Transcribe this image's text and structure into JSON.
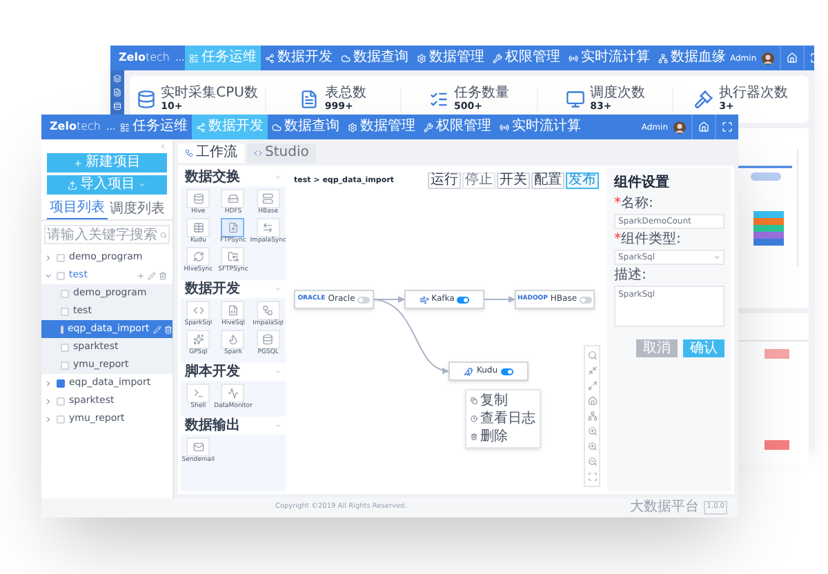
{
  "back_window": {
    "logo": {
      "main": "Zelo",
      "sub": "tech"
    },
    "more": "...",
    "nav": [
      {
        "label": "任务运维",
        "selected": true
      },
      {
        "label": "数据开发",
        "selected": false
      },
      {
        "label": "数据查询",
        "selected": false
      },
      {
        "label": "数据管理",
        "selected": false
      },
      {
        "label": "权限管理",
        "selected": false
      },
      {
        "label": "实时流计算",
        "selected": false
      },
      {
        "label": "数据血缘",
        "selected": false
      }
    ],
    "user": "Admin",
    "stats": [
      {
        "label": "实时采集CPU数",
        "value": "10+"
      },
      {
        "label": "表总数",
        "value": "999+"
      },
      {
        "label": "任务数量",
        "value": "500+"
      },
      {
        "label": "调度次数",
        "value": "83+"
      },
      {
        "label": "执行器次数",
        "value": "3+"
      }
    ]
  },
  "window": {
    "logo": {
      "main": "Zelo",
      "sub": "tech"
    },
    "more": "...",
    "nav": [
      {
        "label": "任务运维",
        "selected": false
      },
      {
        "label": "数据开发",
        "selected": true
      },
      {
        "label": "数据查询",
        "selected": false
      },
      {
        "label": "数据管理",
        "selected": false
      },
      {
        "label": "权限管理",
        "selected": false
      },
      {
        "label": "实时流计算",
        "selected": false
      }
    ],
    "user": "Admin"
  },
  "sidebar": {
    "buttons": [
      "新建项目",
      "导入项目"
    ],
    "tabs": [
      {
        "label": "项目列表",
        "selected": true
      },
      {
        "label": "调度列表",
        "selected": false
      }
    ],
    "search": {
      "placeholder": "请输入关键字搜索"
    },
    "tree": [
      {
        "label": "demo_program",
        "checked": false,
        "selected": false,
        "expanded": false
      },
      {
        "label": "test",
        "checked": false,
        "selected": false,
        "expanded": true,
        "children": [
          {
            "label": "demo_program",
            "checked": false,
            "selected": false
          },
          {
            "label": "test",
            "checked": false,
            "selected": false
          },
          {
            "label": "eqp_data_import",
            "checked": false,
            "selected": true
          },
          {
            "label": "sparktest",
            "checked": false,
            "selected": false
          },
          {
            "label": "ymu_report",
            "checked": false,
            "selected": false
          }
        ]
      },
      {
        "label": "eqp_data_import",
        "checked": true,
        "selected": false,
        "expanded": false
      },
      {
        "label": "sparktest",
        "checked": false,
        "selected": false,
        "expanded": false
      },
      {
        "label": "ymu_report",
        "checked": false,
        "selected": false,
        "expanded": false
      }
    ]
  },
  "editor_tabs": [
    {
      "label": "工作流",
      "selected": true
    },
    {
      "label": "Studio",
      "selected": false
    }
  ],
  "palette": [
    {
      "title": "数据交换",
      "expanded": true,
      "items": [
        {
          "label": "Hive",
          "selected": false
        },
        {
          "label": "HDFS",
          "selected": false
        },
        {
          "label": "HBase",
          "selected": false
        },
        {
          "label": "Kudu",
          "selected": false
        },
        {
          "label": "FTPSync",
          "selected": true
        },
        {
          "label": "ImpalaSync",
          "selected": false
        },
        {
          "label": "HiveSync",
          "selected": false
        },
        {
          "label": "SFTPSync",
          "selected": false
        }
      ]
    },
    {
      "title": "数据开发",
      "expanded": true,
      "items": [
        {
          "label": "SparkSql",
          "selected": false
        },
        {
          "label": "HiveSql",
          "selected": false
        },
        {
          "label": "ImpalaSql",
          "selected": false
        },
        {
          "label": "GPSql",
          "selected": false
        },
        {
          "label": "Spark",
          "selected": false
        },
        {
          "label": "PGSQL",
          "selected": false
        }
      ]
    },
    {
      "title": "脚本开发",
      "expanded": true,
      "items": [
        {
          "label": "Shell",
          "selected": false
        },
        {
          "label": "DataMonitor",
          "selected": false
        }
      ]
    },
    {
      "title": "数据输出",
      "expanded": true,
      "items": [
        {
          "label": "Sendemail",
          "selected": false
        }
      ]
    }
  ],
  "canvas": {
    "breadcrumb": "test > eqp_data_import",
    "toolbar": [
      {
        "label": "运行",
        "kind": "default"
      },
      {
        "label": "停止",
        "kind": "disabled"
      },
      {
        "label": "开关",
        "kind": "default"
      },
      {
        "label": "配置",
        "kind": "default"
      },
      {
        "label": "发布",
        "kind": "primary"
      }
    ],
    "nodes": [
      {
        "logo": "ORACLE",
        "label": "Oracle",
        "on": false
      },
      {
        "label": "Kafka",
        "on": true
      },
      {
        "logo": "HADOOP",
        "label": "HBase",
        "on": false
      },
      {
        "label": "Kudu",
        "on": true
      }
    ],
    "context_menu": [
      "复制",
      "查看日志",
      "删除"
    ]
  },
  "settings": {
    "title": "组件设置",
    "fields": [
      {
        "required_mark": "*",
        "label": "名称:",
        "kind": "input",
        "value": "SparkDemoCount"
      },
      {
        "required_mark": "*",
        "label": "组件类型:",
        "kind": "select",
        "value": "SparkSql"
      },
      {
        "label": "描述:",
        "kind": "textarea",
        "value": "SparkSql"
      }
    ],
    "buttons": [
      {
        "label": "取消",
        "kind": "secondary"
      },
      {
        "label": "确认",
        "kind": "primary"
      }
    ]
  },
  "footer": {
    "copyright": "Copyright ©2019 All Rights Reserved.",
    "product": "大数据平台",
    "version": "1.0.0"
  }
}
